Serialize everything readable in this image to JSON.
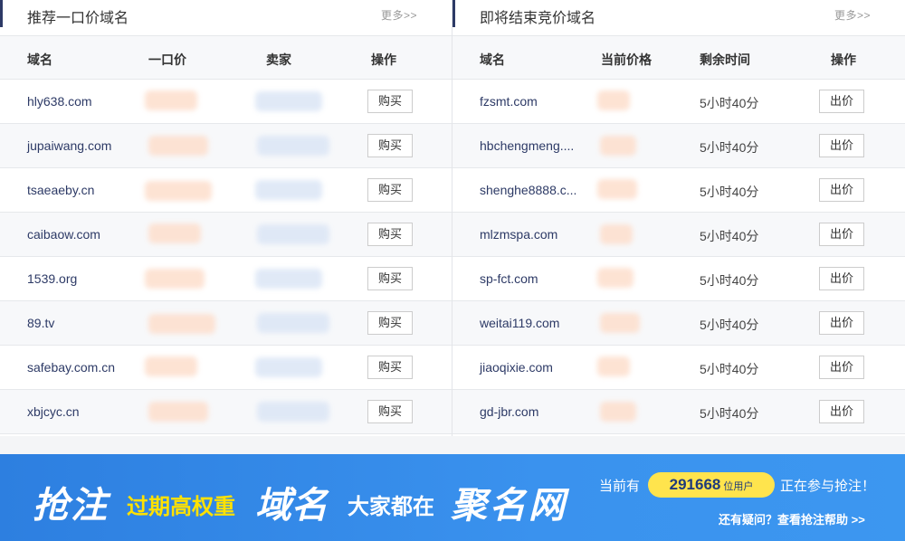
{
  "left": {
    "title": "推荐一口价域名",
    "more": "更多>>",
    "columns": [
      "域名",
      "一口价",
      "卖家",
      "操作"
    ],
    "rows": [
      {
        "domain": "hly638.com",
        "action": "购买"
      },
      {
        "domain": "jupaiwang.com",
        "action": "购买"
      },
      {
        "domain": "tsaeaeby.cn",
        "action": "购买"
      },
      {
        "domain": "caibaow.com",
        "action": "购买"
      },
      {
        "domain": "1539.org",
        "action": "购买"
      },
      {
        "domain": "89.tv",
        "action": "购买"
      },
      {
        "domain": "safebay.com.cn",
        "action": "购买"
      },
      {
        "domain": "xbjcyc.cn",
        "action": "购买"
      }
    ]
  },
  "right": {
    "title": "即将结束竞价域名",
    "more": "更多>>",
    "columns": [
      "域名",
      "当前价格",
      "剩余时间",
      "操作"
    ],
    "rows": [
      {
        "domain": "fzsmt.com",
        "time": "5小时40分",
        "action": "出价"
      },
      {
        "domain": "hbchengmeng....",
        "time": "5小时40分",
        "action": "出价"
      },
      {
        "domain": "shenghe8888.c...",
        "time": "5小时40分",
        "action": "出价"
      },
      {
        "domain": "mlzmspa.com",
        "time": "5小时40分",
        "action": "出价"
      },
      {
        "domain": "sp-fct.com",
        "time": "5小时40分",
        "action": "出价"
      },
      {
        "domain": "weitai119.com",
        "time": "5小时40分",
        "action": "出价"
      },
      {
        "domain": "jiaoqixie.com",
        "time": "5小时40分",
        "action": "出价"
      },
      {
        "domain": "gd-jbr.com",
        "time": "5小时40分",
        "action": "出价"
      }
    ]
  },
  "banner": {
    "w1": "抢注",
    "w2": "过期高权重",
    "w3": "域名",
    "w4": "大家都在",
    "w5": "聚名网",
    "prefix": "当前有",
    "count": "291668",
    "unit": "位用户",
    "suffix": "正在参与抢注！",
    "help": "还有疑问？查看抢注帮助 >>"
  },
  "colors": {
    "accent": "#2d3a66",
    "banner": "#3a92ee",
    "highlight": "#ffe44d"
  }
}
